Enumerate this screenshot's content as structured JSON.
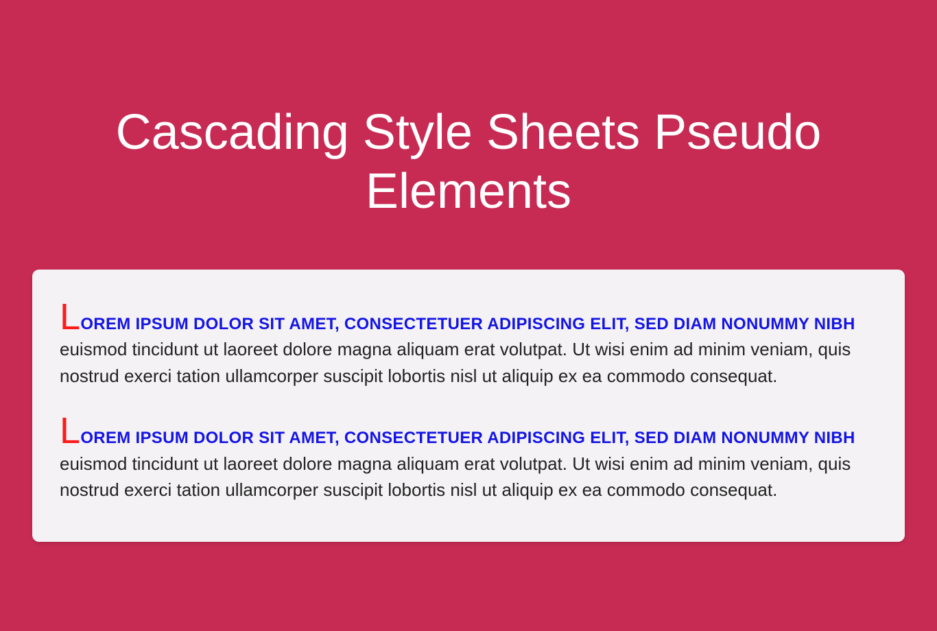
{
  "header": {
    "title": "Cascading Style Sheets Pseudo Elements"
  },
  "card": {
    "paragraphs": [
      {
        "first_letter": "L",
        "first_line_rest": "orem ipsum dolor sit amet, consectetuer adipiscing elit, sed diam nonummy nibh",
        "body_rest": "euismod tincidunt ut laoreet dolore magna aliquam erat volutpat. Ut wisi enim ad minim veniam, quis nostrud exerci tation ullamcorper suscipit lobortis nisl ut aliquip ex ea commodo consequat."
      },
      {
        "first_letter": "L",
        "first_line_rest": "orem ipsum dolor sit amet, consectetuer adipiscing elit, sed diam nonummy nibh",
        "body_rest": "euismod tincidunt ut laoreet dolore magna aliquam erat volutpat. Ut wisi enim ad minim veniam, quis nostrud exerci tation ullamcorper suscipit lobortis nisl ut aliquip ex ea commodo consequat."
      }
    ]
  }
}
